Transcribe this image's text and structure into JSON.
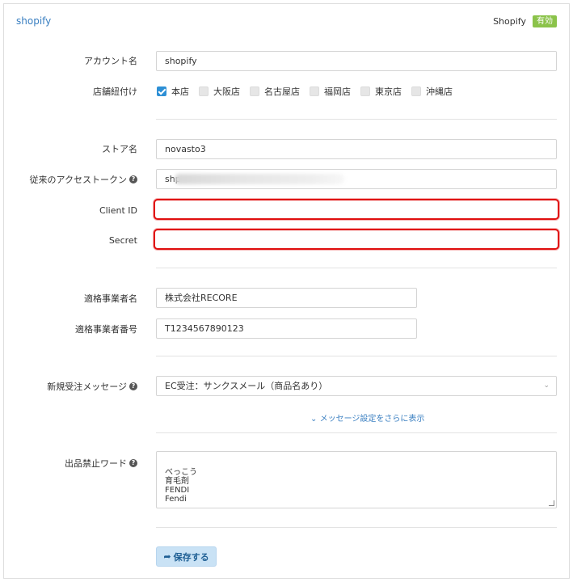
{
  "header": {
    "title": "shopify",
    "service": "Shopify",
    "status_badge": "有効",
    "badge_color": "#8bc34a"
  },
  "account": {
    "label": "アカウント名",
    "value": "shopify"
  },
  "stores": {
    "label": "店舗紐付け",
    "items": [
      {
        "label": "本店",
        "checked": true
      },
      {
        "label": "大阪店",
        "checked": false
      },
      {
        "label": "名古屋店",
        "checked": false
      },
      {
        "label": "福岡店",
        "checked": false
      },
      {
        "label": "東京店",
        "checked": false
      },
      {
        "label": "沖縄店",
        "checked": false
      }
    ]
  },
  "store_name": {
    "label": "ストア名",
    "value": "novasto3"
  },
  "legacy_token": {
    "label": "従来のアクセストークン",
    "value_visible": "shp"
  },
  "client_id": {
    "label": "Client ID",
    "value": ""
  },
  "secret": {
    "label": "Secret",
    "value": ""
  },
  "qualified_business_name": {
    "label": "適格事業者名",
    "value": "株式会社RECORE"
  },
  "qualified_business_number": {
    "label": "適格事業者番号",
    "value": "T1234567890123"
  },
  "new_order_message": {
    "label": "新規受注メッセージ",
    "selected": "EC受注：サンクスメール（商品名あり）",
    "more_link": "メッセージ設定をさらに表示"
  },
  "prohibited_words": {
    "label": "出品禁止ワード",
    "value": "べっこう\n育毛剤\nFENDI\nFendi"
  },
  "save_button": {
    "label": "保存する"
  },
  "colors": {
    "accent": "#3a7fc1",
    "highlight_border": "#e01010",
    "checkbox_checked": "#2d8fd5"
  }
}
